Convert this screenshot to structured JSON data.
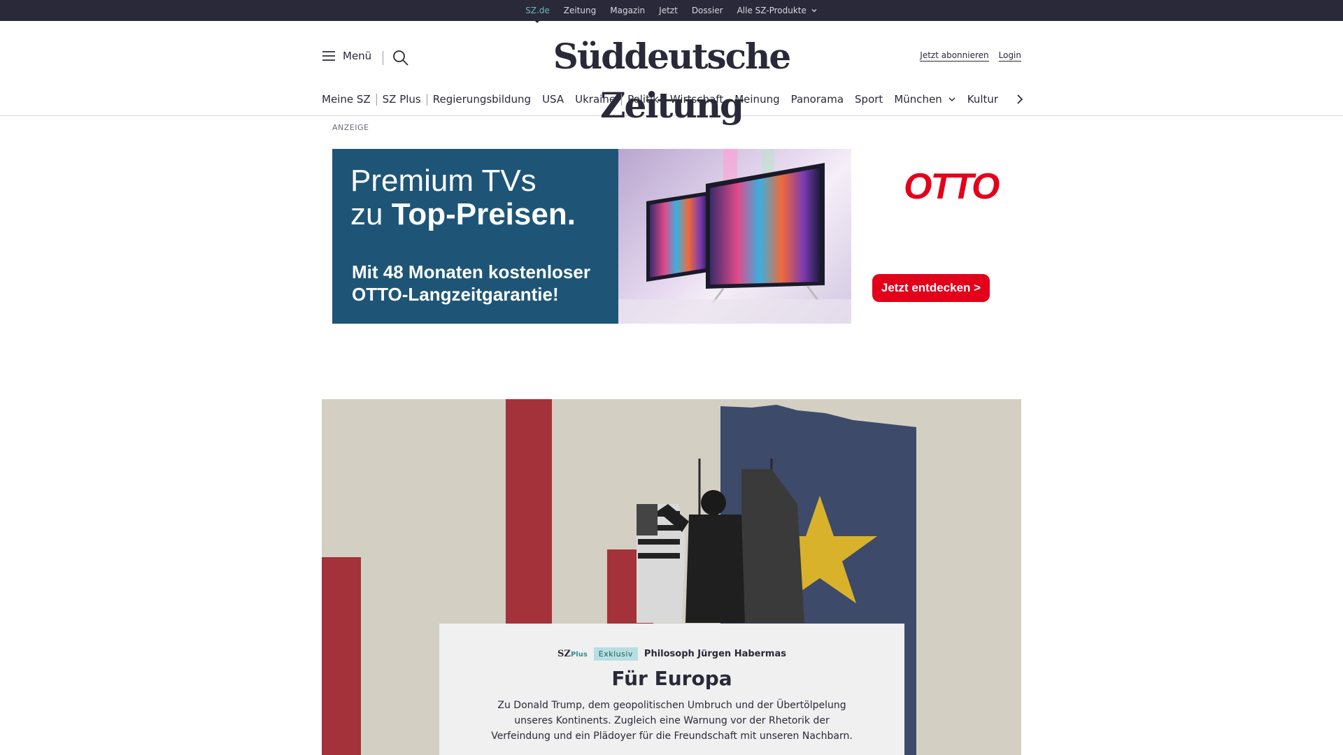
{
  "topbar": {
    "items": [
      {
        "label": "SZ.de",
        "active": true
      },
      {
        "label": "Zeitung"
      },
      {
        "label": "Magazin"
      },
      {
        "label": "Jetzt"
      },
      {
        "label": "Dossier"
      },
      {
        "label": "Alle SZ-Produkte",
        "dropdown": true
      }
    ]
  },
  "header": {
    "menu_label": "Menü",
    "logo_text": "Süddeutsche Zeitung",
    "subscribe_label": "Jetzt abonnieren",
    "login_label": "Login"
  },
  "nav": {
    "items": [
      "Meine SZ",
      "SZ Plus",
      "Regierungsbildung",
      "USA",
      "Ukraine",
      "Politik",
      "Wirtschaft",
      "Meinung",
      "Panorama",
      "Sport",
      "München",
      "Kultur"
    ]
  },
  "ad": {
    "label": "ANZEIGE",
    "headline_line1": "Premium TVs",
    "headline_line2_prefix": "zu ",
    "headline_line2_bold": "Top-Preisen.",
    "subline": "Mit 48 Monaten kostenloser OTTO-Langzeitgarantie!",
    "brand": "OTTO",
    "cta": "Jetzt entdecken >"
  },
  "teaser": {
    "plus_brand": "SZ",
    "plus_suffix": "Plus",
    "badge": "Exklusiv",
    "kicker": "Philosoph Jürgen Habermas",
    "headline": "Für Europa",
    "text": "Zu Donald Trump, dem geopolitischen Umbruch und der Übertölpelung unseres Kontinents. Zugleich eine Warnung vor der Rhetorik der Verfeindung und ein Plädoyer für die Freundschaft mit unseren Nachbarn."
  },
  "colors": {
    "topbar_bg": "#29293a",
    "active_link": "#71b5bc",
    "ad_blue": "#1e5576",
    "otto_red": "#e3001b",
    "teaser_bg": "#d3cfc2",
    "teaser_red": "#a4323a",
    "teaser_blue": "#3d4a6a",
    "star_yellow": "#d8b22b"
  },
  "icons": [
    "hamburger-icon",
    "search-icon",
    "chevron-down-icon",
    "chevron-right-icon",
    "star-icon"
  ]
}
